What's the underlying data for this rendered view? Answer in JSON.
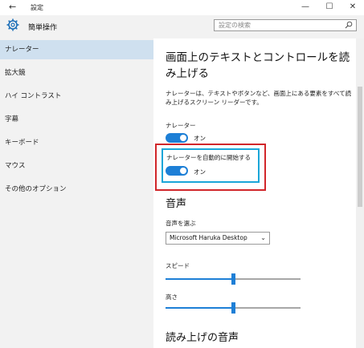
{
  "window": {
    "title": "設定"
  },
  "header": {
    "title": "簡単操作",
    "search_placeholder": "設定の検索"
  },
  "sidebar": {
    "items": [
      {
        "label": "ナレーター",
        "selected": true
      },
      {
        "label": "拡大鏡"
      },
      {
        "label": "ハイ コントラスト"
      },
      {
        "label": "字幕"
      },
      {
        "label": "キーボード"
      },
      {
        "label": "マウス"
      },
      {
        "label": "その他のオプション"
      }
    ]
  },
  "main": {
    "heading": "画面上のテキストとコントロールを読み上げる",
    "description": "ナレーターは、テキストやボタンなど、画面上にある要素をすべて読み上げるスクリーン リーダーです。",
    "narrator": {
      "label": "ナレーター",
      "state": "オン"
    },
    "auto_start": {
      "label": "ナレーターを自動的に開始する",
      "state": "オン"
    },
    "voice_section": "音声",
    "voice_select": {
      "label": "音声を選ぶ",
      "value": "Microsoft Haruka Desktop"
    },
    "speed": {
      "label": "スピード",
      "value": 0.5
    },
    "pitch": {
      "label": "高さ",
      "value": 0.5
    },
    "reading_section": "読み上げの音声"
  },
  "colors": {
    "accent": "#1d7fd6",
    "highlight_red": "#d1262a",
    "highlight_blue": "#1aa6d8"
  }
}
